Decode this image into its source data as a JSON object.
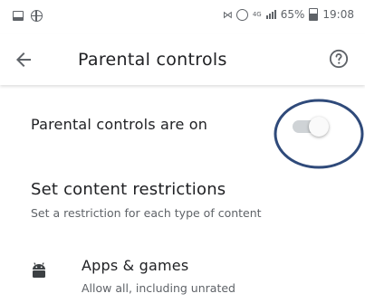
{
  "status_bar": {
    "network": "4G",
    "battery": "65%",
    "time": "19:08"
  },
  "app_bar": {
    "title": "Parental controls",
    "back_icon": "arrow-left-icon",
    "help_icon": "help-circle-icon"
  },
  "toggle": {
    "label": "Parental controls are on",
    "state": "on"
  },
  "restrictions": {
    "title": "Set content restrictions",
    "subtitle": "Set a restriction for each type of content"
  },
  "apps_games": {
    "icon": "android-icon",
    "title": "Apps & games",
    "subtitle": "Allow all, including unrated"
  },
  "colors": {
    "annotation": "#2f4a7a",
    "track": "#cfd3d6",
    "thumb": "#fafafa"
  }
}
